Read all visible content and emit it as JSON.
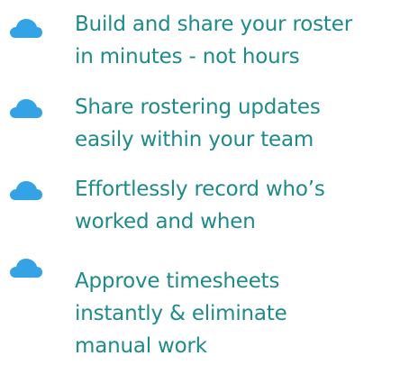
{
  "colors": {
    "accent_icon": "#33a3e6",
    "text": "#1f8a8a",
    "background": "#ffffff"
  },
  "features": [
    {
      "icon": "cloud-icon",
      "text": "Build and share your roster\nin minutes - not hours"
    },
    {
      "icon": "cloud-icon",
      "text": "Share rostering updates\neasily within your team"
    },
    {
      "icon": "cloud-icon",
      "text": "Effortlessly record who’s\nworked and when"
    },
    {
      "icon": "cloud-icon",
      "text": "Approve timesheets\ninstantly & eliminate\nmanual work"
    }
  ]
}
